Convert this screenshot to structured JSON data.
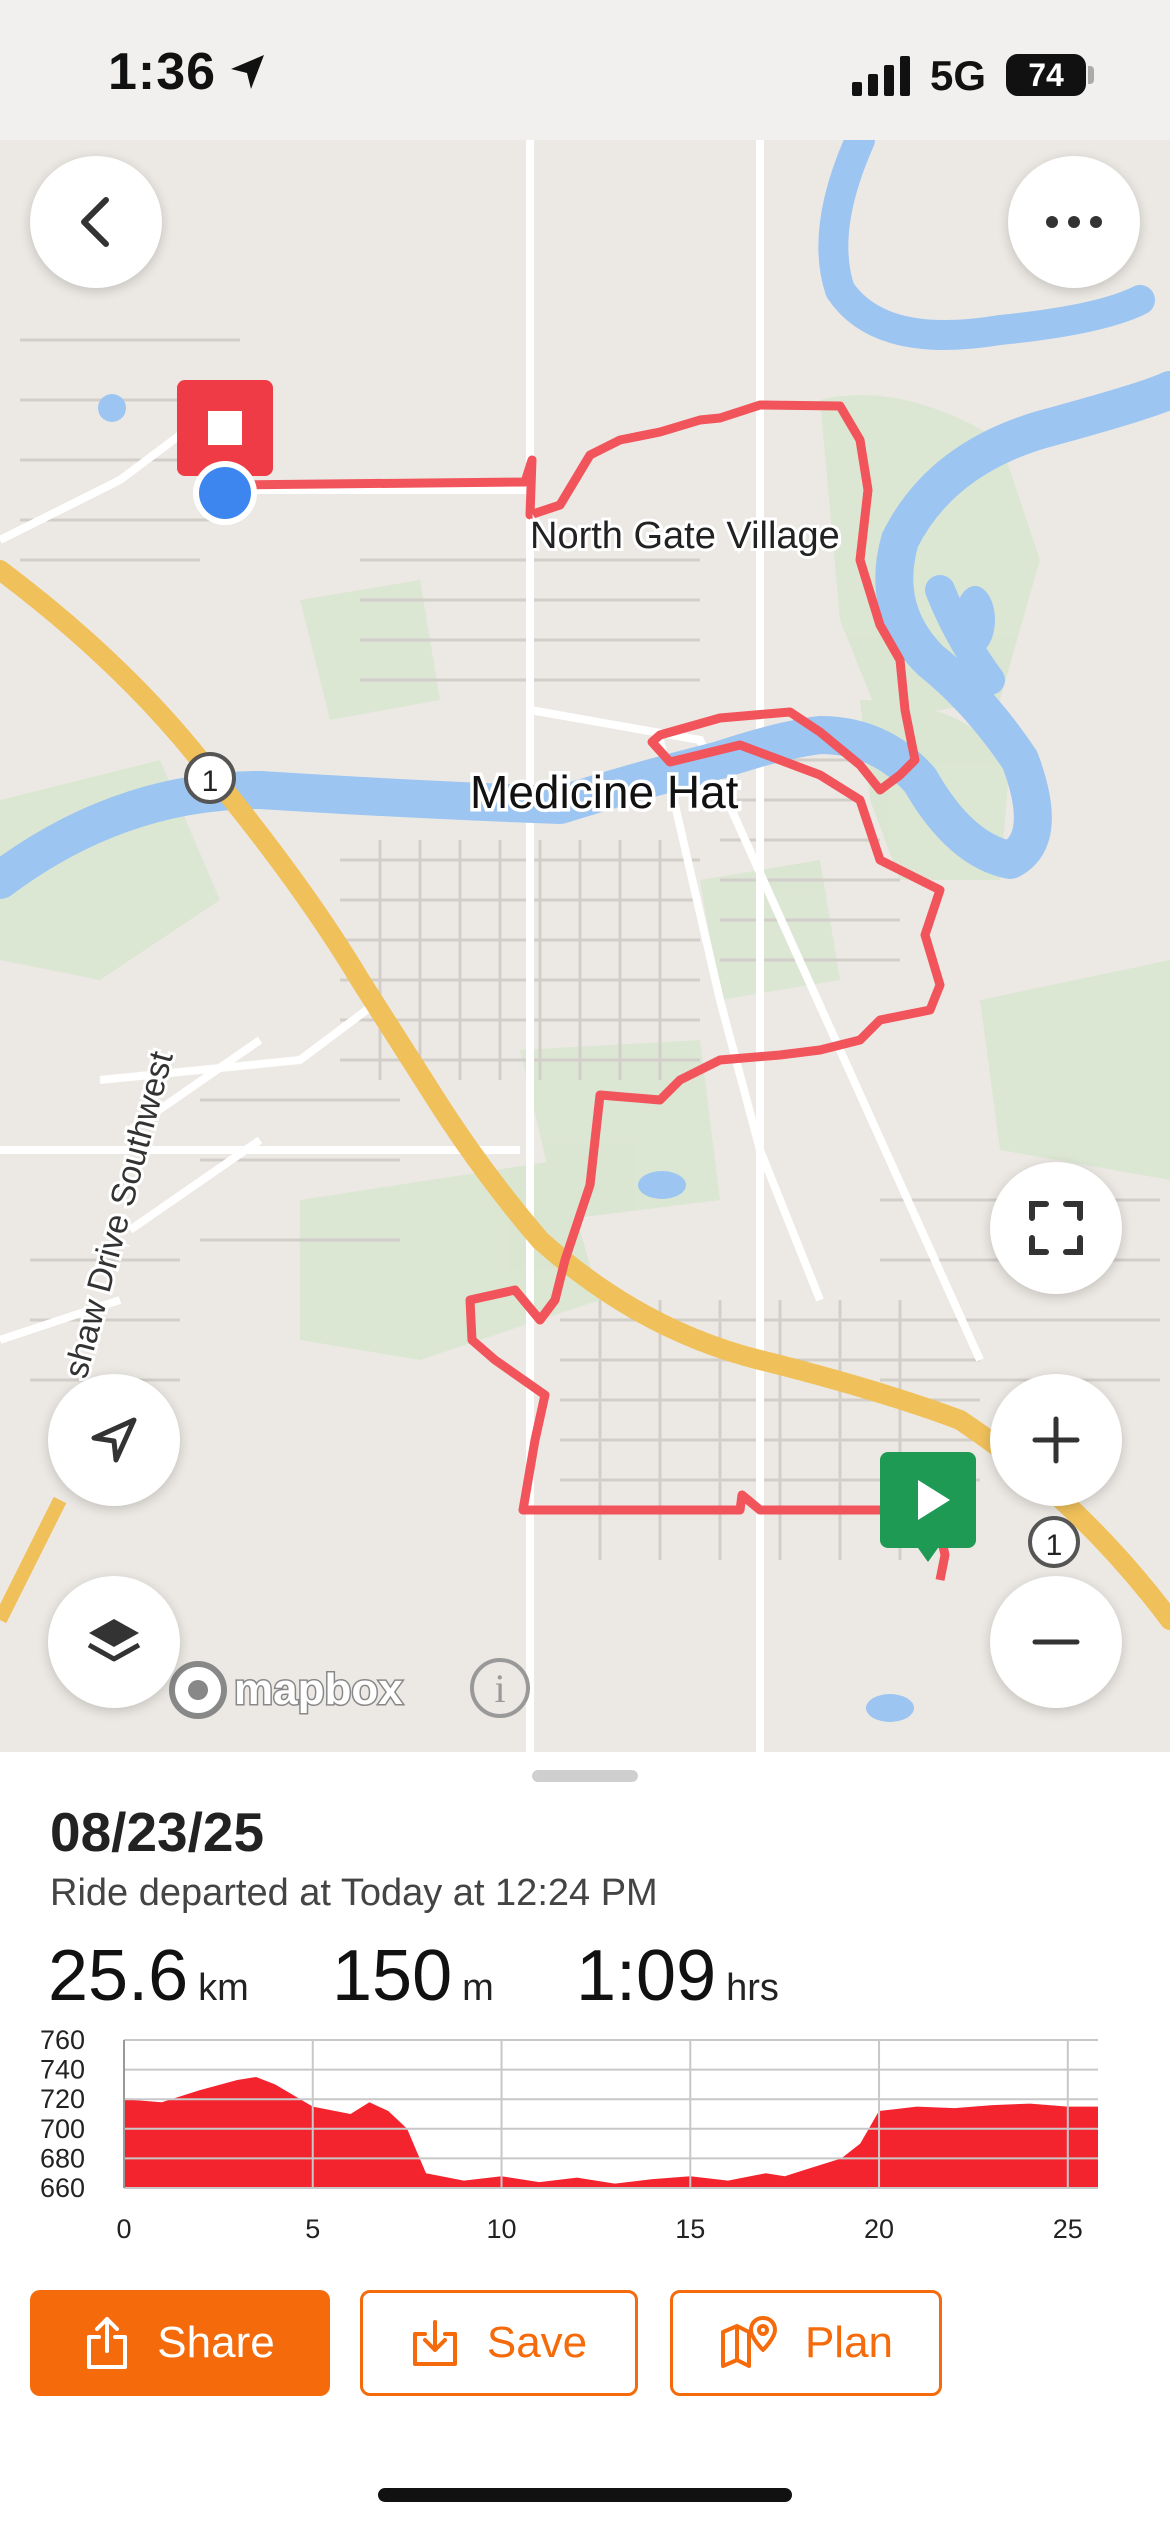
{
  "status_bar": {
    "time": "1:36",
    "network": "5G",
    "battery": "74"
  },
  "map": {
    "labels": {
      "north_gate": "North Gate Village",
      "city": "Medicine Hat",
      "drive": "shaw Drive Southwest",
      "highway_1a": "1",
      "highway_1b": "1"
    },
    "attribution": "mapbox",
    "colors": {
      "route": "#f2545b",
      "river": "#9cc5f2",
      "start_marker": "#1e9a55",
      "end_marker": "#ef3b45",
      "current_location": "#3d86f0"
    }
  },
  "ride": {
    "date": "08/23/25",
    "subtitle": "Ride departed at Today at 12:24 PM",
    "distance": {
      "value": "25.6",
      "unit": "km"
    },
    "elevation": {
      "value": "150",
      "unit": "m"
    },
    "duration": {
      "value": "1:09",
      "unit": "hrs"
    }
  },
  "chart_data": {
    "type": "area",
    "x": [
      0,
      1,
      2,
      3,
      3.5,
      4,
      5,
      6,
      6.5,
      7,
      7.5,
      8,
      9,
      10,
      11,
      12,
      13,
      14,
      15,
      16,
      17,
      17.5,
      18,
      19,
      19.5,
      20,
      21,
      22,
      23,
      24,
      25,
      25.8
    ],
    "y": [
      720,
      718,
      726,
      733,
      735,
      730,
      715,
      710,
      718,
      712,
      700,
      670,
      665,
      668,
      664,
      667,
      663,
      666,
      668,
      665,
      670,
      668,
      672,
      680,
      690,
      712,
      715,
      714,
      716,
      717,
      715,
      715
    ],
    "xlim": [
      0,
      25.8
    ],
    "ylim": [
      660,
      760
    ],
    "xticks": [
      "0",
      "5",
      "10",
      "15",
      "20",
      "25"
    ],
    "yticks": [
      "760",
      "740",
      "720",
      "700",
      "680",
      "660"
    ],
    "grid": true,
    "color": "#f4242f"
  },
  "actions": {
    "share": "Share",
    "save": "Save",
    "plan": "Plan"
  }
}
